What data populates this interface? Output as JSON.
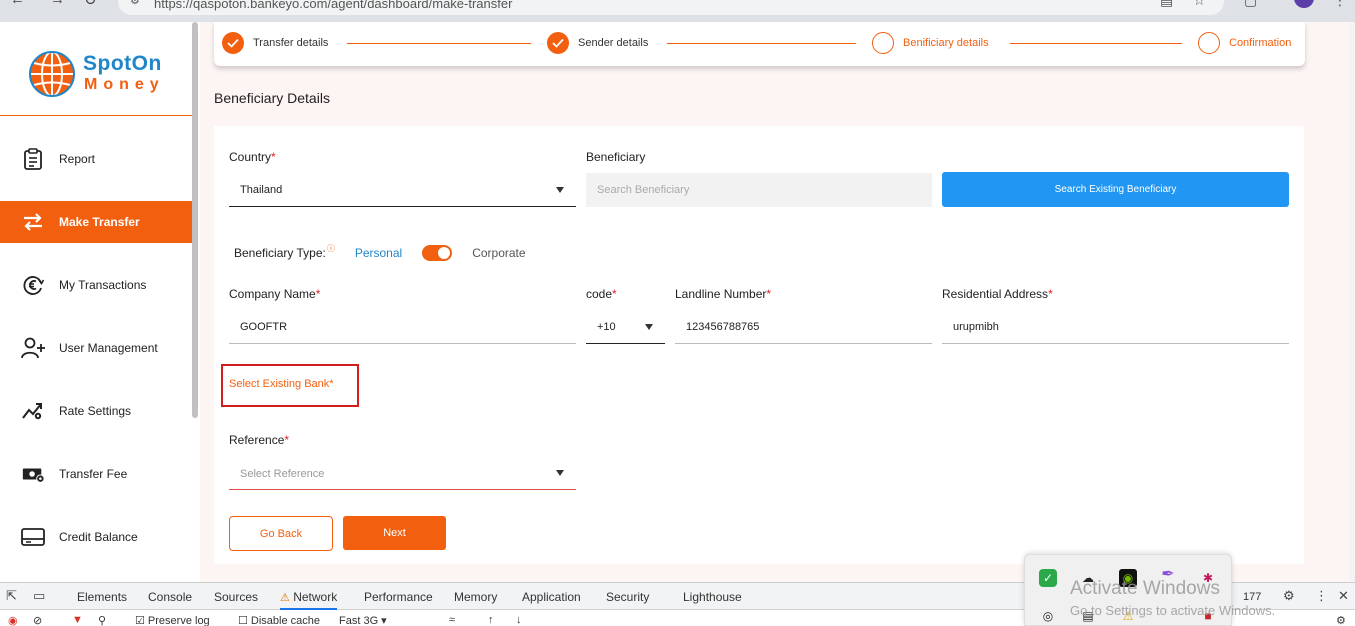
{
  "browser": {
    "url": "https://qaspoton.bankeyo.com/agent/dashboard/make-transfer"
  },
  "logo": {
    "line1": "SpotOn",
    "line2": "Money"
  },
  "sidebar": {
    "items": [
      {
        "label": "Report",
        "icon": "clipboard-icon",
        "active": false
      },
      {
        "label": "Make Transfer",
        "icon": "transfer-arrows-icon",
        "active": true
      },
      {
        "label": "My Transactions",
        "icon": "euro-exchange-icon",
        "active": false
      },
      {
        "label": "User Management",
        "icon": "add-user-icon",
        "active": false
      },
      {
        "label": "Rate Settings",
        "icon": "rate-chart-gear-icon",
        "active": false
      },
      {
        "label": "Transfer Fee",
        "icon": "cash-gear-icon",
        "active": false
      },
      {
        "label": "Credit Balance",
        "icon": "card-icon",
        "active": false
      }
    ]
  },
  "stepper": {
    "steps": [
      {
        "label": "Transfer details",
        "done": true
      },
      {
        "label": "Sender details",
        "done": true
      },
      {
        "label": "Benificiary details",
        "done": false
      },
      {
        "label": "Confirmation",
        "done": false
      }
    ]
  },
  "page": {
    "title": "Beneficiary Details"
  },
  "form": {
    "country": {
      "label": "Country",
      "value": "Thailand"
    },
    "beneficiary": {
      "label": "Beneficiary",
      "placeholder": "Search Beneficiary"
    },
    "search_button": "Search Existing Beneficiary",
    "type": {
      "label": "Beneficiary Type:",
      "option_personal": "Personal",
      "option_corporate": "Corporate",
      "selected": "Corporate"
    },
    "company_name": {
      "label": "Company Name",
      "value": "GOOFTR"
    },
    "code": {
      "label": "code",
      "value": "+10"
    },
    "landline": {
      "label": "Landline Number",
      "value": "123456788765"
    },
    "address": {
      "label": "Residential Address",
      "value": "urupmibh"
    },
    "bank": {
      "label": "Select Existing Bank"
    },
    "reference": {
      "label": "Reference",
      "placeholder": "Select Reference"
    },
    "required_mark": "*",
    "back_button": "Go Back",
    "next_button": "Next"
  },
  "devtools": {
    "tabs": [
      "Elements",
      "Console",
      "Sources",
      "Network",
      "Performance",
      "Memory",
      "Application",
      "Security",
      "Lighthouse"
    ],
    "active_tab": "Network",
    "preserve_log": "Preserve log",
    "disable_cache": "Disable cache",
    "throttle": "Fast 3G",
    "notification_count": "177"
  },
  "watermark": {
    "line1": "Activate Windows",
    "line2": "Go to Settings to activate Windows."
  },
  "colors": {
    "brand_orange": "#f25f0f",
    "brand_blue": "#1f86c9",
    "search_button": "#2196f3",
    "highlight_red": "#d41e1e"
  }
}
